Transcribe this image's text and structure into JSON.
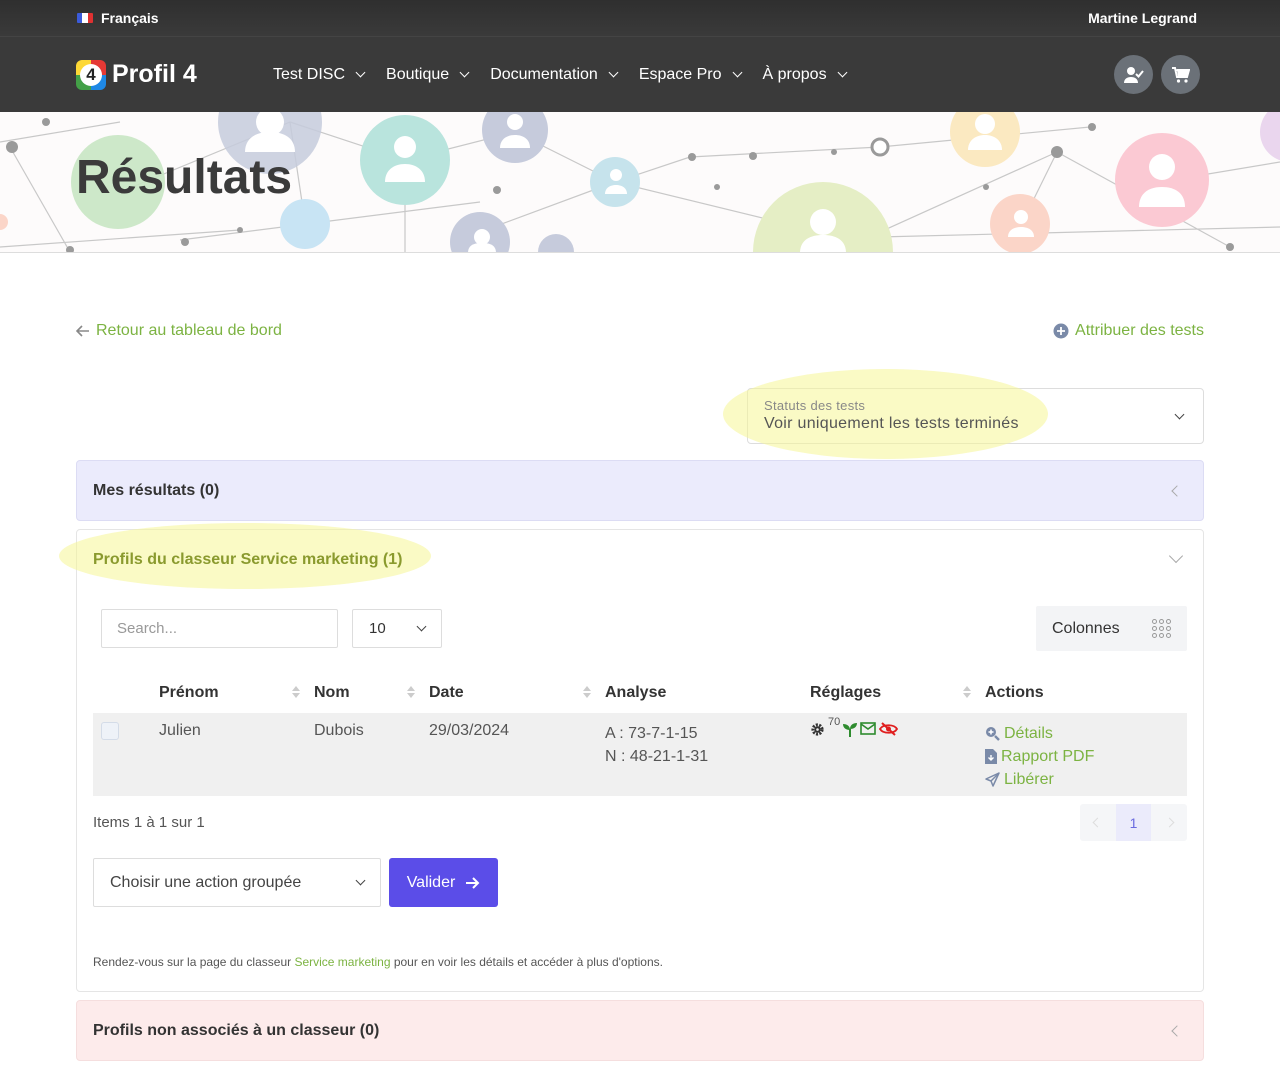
{
  "topbar": {
    "language": "Français",
    "user": "Martine Legrand"
  },
  "nav": {
    "brand": "Profil 4",
    "brand_badge": "4",
    "items": [
      {
        "label": "Test DISC"
      },
      {
        "label": "Boutique"
      },
      {
        "label": "Documentation"
      },
      {
        "label": "Espace Pro"
      },
      {
        "label": "À propos"
      }
    ]
  },
  "hero": {
    "title": "Résultats"
  },
  "links": {
    "back": "Retour au tableau de bord",
    "assign": "Attribuer des tests"
  },
  "status_filter": {
    "label": "Statuts des tests",
    "value": "Voir uniquement les tests terminés"
  },
  "panels": {
    "mine": {
      "title": "Mes résultats (0)"
    },
    "folder": {
      "title": "Profils du classeur Service marketing (1)"
    },
    "unassigned": {
      "title": "Profils non associés à un classeur (0)"
    }
  },
  "table_controls": {
    "search_placeholder": "Search...",
    "per_page": "10",
    "columns_label": "Colonnes"
  },
  "table": {
    "headers": [
      "Prénom",
      "Nom",
      "Date",
      "Analyse",
      "Réglages",
      "Actions"
    ],
    "rows": [
      {
        "prenom": "Julien",
        "nom": "Dubois",
        "date": "29/03/2024",
        "analyse_a": "A : 73-7-1-15",
        "analyse_n": "N : 48-21-1-31",
        "reglage_value": "70",
        "actions": [
          "Détails",
          "Rapport PDF",
          "Libérer"
        ]
      }
    ]
  },
  "pagination": {
    "summary": "Items 1 à 1 sur 1",
    "current_page": "1"
  },
  "bulk": {
    "select_label": "Choisir une action groupée",
    "submit_label": "Valider"
  },
  "note": {
    "before": "Rendez-vous sur la page du classeur ",
    "link": "Service marketing",
    "after": " pour en voir les détails et accéder à plus d'options."
  },
  "colors": {
    "accent_green": "#7cb342",
    "primary": "#5b4de8",
    "navbar": "#3a3a3a"
  }
}
